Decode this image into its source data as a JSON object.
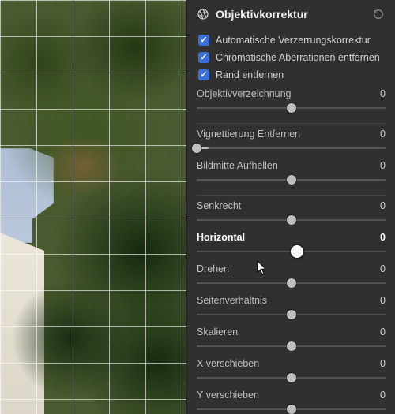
{
  "panel": {
    "title": "Objektivkorrektur",
    "icons": {
      "header": "aperture-icon",
      "reset": "reset-icon"
    }
  },
  "checks": [
    {
      "label": "Automatische Verzerrungskorrektur",
      "checked": true
    },
    {
      "label": "Chromatische Aberrationen entfernen",
      "checked": true
    },
    {
      "label": "Rand entfernen",
      "checked": true
    }
  ],
  "sliders": [
    {
      "id": "distortion",
      "label": "Objektivverzeichnung",
      "value": 0,
      "pos": 50
    },
    {
      "id": "devignette",
      "label": "Vignettierung Entfernen",
      "value": 0,
      "pos": 0,
      "separator_before": true
    },
    {
      "id": "centerlight",
      "label": "Bildmitte Aufhellen",
      "value": 0,
      "pos": 50
    },
    {
      "id": "vertical",
      "label": "Senkrecht",
      "value": 0,
      "pos": 50,
      "separator_before": true
    },
    {
      "id": "horizontal",
      "label": "Horizontal",
      "value": 0,
      "pos": 53,
      "accent": true
    },
    {
      "id": "rotate",
      "label": "Drehen",
      "value": 0,
      "pos": 50
    },
    {
      "id": "aspect",
      "label": "Seitenverhältnis",
      "value": 0,
      "pos": 50
    },
    {
      "id": "scale",
      "label": "Skalieren",
      "value": 0,
      "pos": 50
    },
    {
      "id": "xshift",
      "label": "X verschieben",
      "value": 0,
      "pos": 50
    },
    {
      "id": "yshift",
      "label": "Y verschieben",
      "value": 0,
      "pos": 50
    }
  ]
}
